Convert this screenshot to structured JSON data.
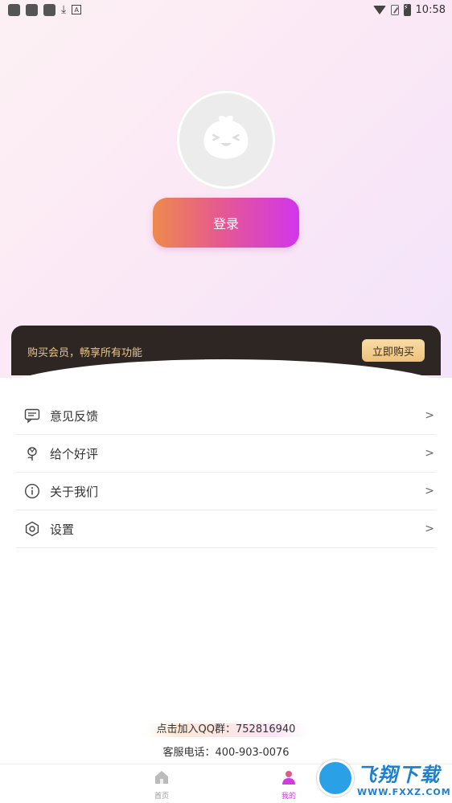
{
  "status_bar": {
    "time": "10:58"
  },
  "profile": {
    "login_label": "登录"
  },
  "vip": {
    "text": "购买会员，畅享所有功能",
    "buy_label": "立即购买"
  },
  "menu": {
    "items": [
      {
        "label": "意见反馈",
        "icon": "message-icon"
      },
      {
        "label": "给个好评",
        "icon": "flower-icon"
      },
      {
        "label": "关于我们",
        "icon": "info-icon"
      },
      {
        "label": "设置",
        "icon": "settings-icon"
      }
    ],
    "chevron": ">"
  },
  "footer": {
    "qq": "点击加入QQ群：752816940",
    "phone": "客服电话：400-903-0076"
  },
  "tabs": [
    {
      "label": "首页",
      "icon": "home-icon"
    },
    {
      "label": "我的",
      "icon": "user-icon"
    }
  ],
  "watermark": {
    "big": "飞翔下载",
    "small": "WWW.FXXZ.COM"
  },
  "colors": {
    "accent": "#d235ec",
    "vip_bg": "#2e2623",
    "vip_text": "#e9c58d"
  }
}
